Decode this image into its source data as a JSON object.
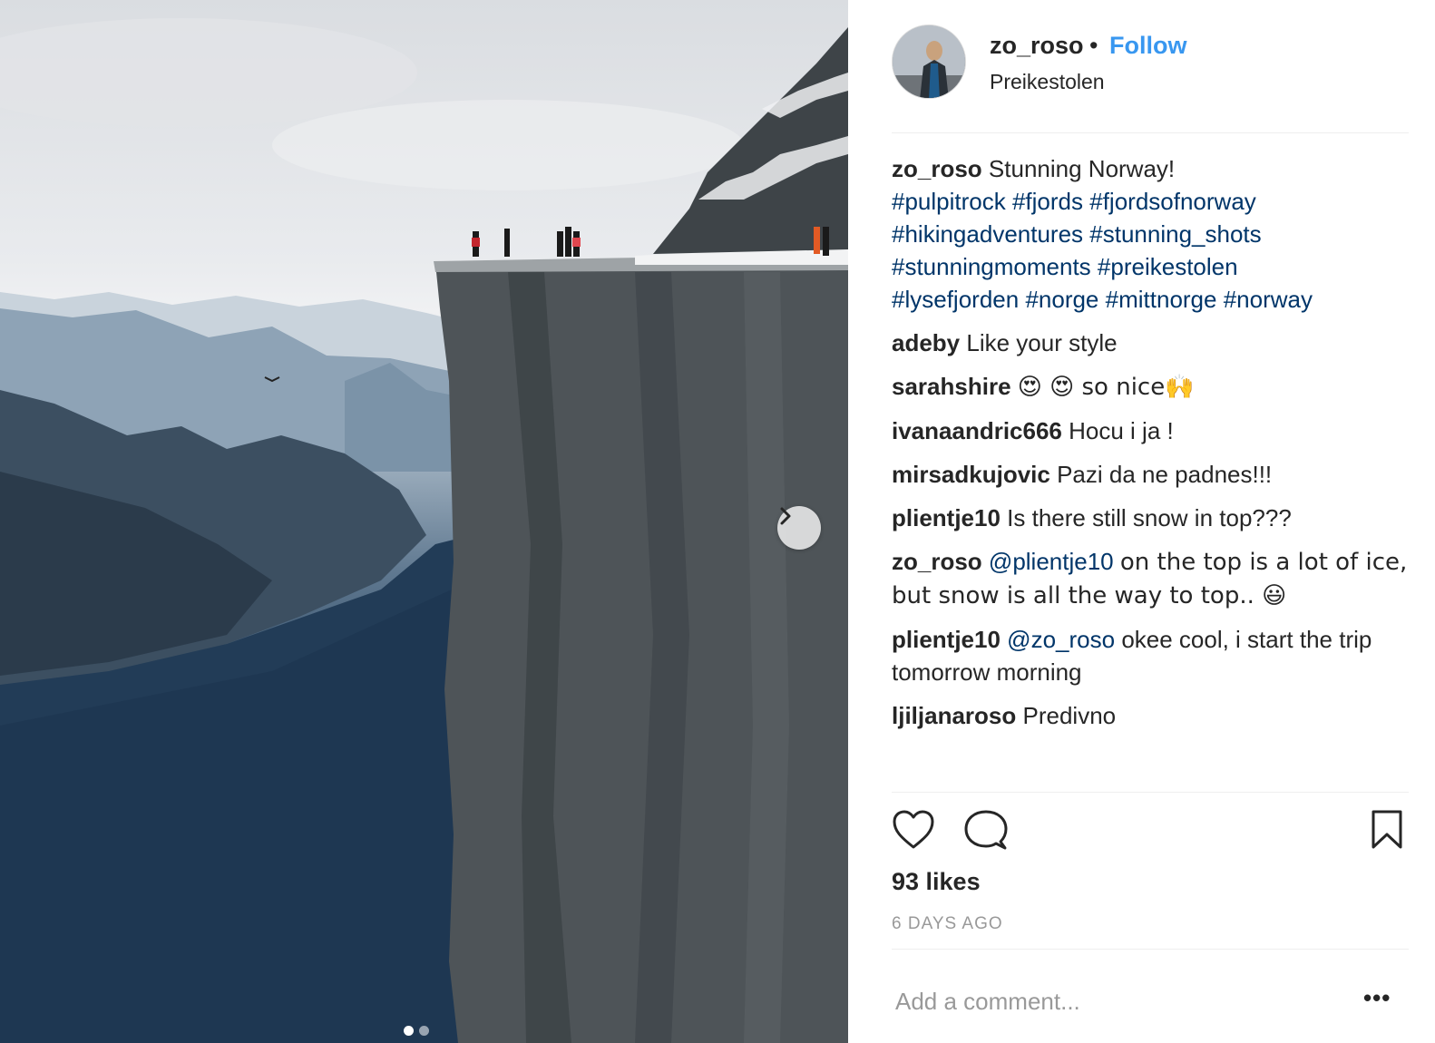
{
  "post": {
    "username": "zo_roso",
    "bullet": "•",
    "follow_label": "Follow",
    "location": "Preikestolen",
    "likes": "93 likes",
    "time": "6 DAYS AGO",
    "add_comment_placeholder": "Add a comment...",
    "more_label": "•••",
    "carousel": {
      "slide_count": 2,
      "active_slide": 1
    }
  },
  "caption": {
    "user": "zo_roso",
    "text": "Stunning Norway!",
    "tags": [
      "#pulpitrock",
      "#fjords",
      "#fjordsofnorway",
      "#hikingadventures",
      "#stunning_shots",
      "#stunningmoments",
      "#preikestolen",
      "#lysefjorden",
      "#norge",
      "#mittnorge",
      "#norway"
    ]
  },
  "comments": [
    {
      "user": "adeby",
      "text": "Like your style"
    },
    {
      "user": "sarahshire",
      "text": "😍 😍 so nice🙌"
    },
    {
      "user": "ivanaandric666",
      "text": "Hocu i ja !"
    },
    {
      "user": "mirsadkujovic",
      "text": "Pazi da ne padnes!!!"
    },
    {
      "user": "plientje10",
      "text": "Is there still snow in top???"
    },
    {
      "user": "zo_roso",
      "mention": "@plientje10",
      "text": "on the top is a lot of ice, but snow is all the way to top.. 😃"
    },
    {
      "user": "plientje10",
      "mention": "@zo_roso",
      "text": "okee cool, i start the trip tomorrow morning"
    },
    {
      "user": "ljiljanaroso",
      "text": "Predivno"
    }
  ],
  "colors": {
    "link_blue": "#3897f0",
    "hashtag_blue": "#003569",
    "text": "#262626",
    "muted": "#999999"
  },
  "icons": [
    "heart-icon",
    "comment-icon",
    "bookmark-icon",
    "chevron-right-icon"
  ]
}
